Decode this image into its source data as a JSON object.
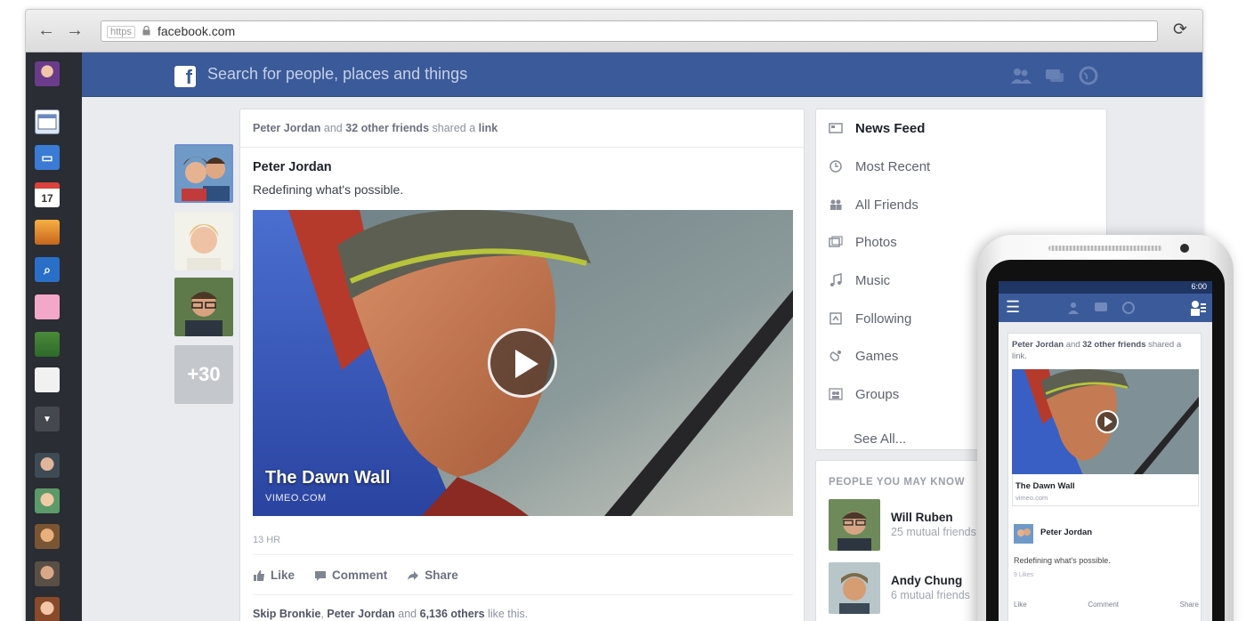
{
  "browser": {
    "url_scheme": "https",
    "url": "facebook.com"
  },
  "header": {
    "search_placeholder": "Search for people, places and things"
  },
  "friends_strip": {
    "more_count": "+30"
  },
  "post": {
    "shared_by": "Peter Jordan",
    "shared_and": "and",
    "shared_others": "32 other friends",
    "shared_verb": "shared a",
    "shared_object": "link",
    "author": "Peter Jordan",
    "text": "Redefining what's possible.",
    "video_title": "The Dawn Wall",
    "video_domain": "VIMEO.COM",
    "time": "13 HR",
    "actions": {
      "like": "Like",
      "comment": "Comment",
      "share": "Share"
    },
    "likes_name1": "Skip Bronkie",
    "likes_name2": "Peter Jordan",
    "likes_and": "and",
    "likes_count": "6,136 others",
    "likes_suffix": "like this."
  },
  "nav": {
    "items": [
      {
        "label": "News Feed",
        "icon": "news-feed-icon"
      },
      {
        "label": "Most Recent",
        "icon": "clock-icon"
      },
      {
        "label": "All Friends",
        "icon": "friends-icon"
      },
      {
        "label": "Photos",
        "icon": "photos-icon"
      },
      {
        "label": "Music",
        "icon": "music-icon"
      },
      {
        "label": "Following",
        "icon": "following-icon"
      },
      {
        "label": "Games",
        "icon": "games-icon"
      },
      {
        "label": "Groups",
        "icon": "groups-icon"
      }
    ],
    "see_all": "See All..."
  },
  "pymk": {
    "title": "PEOPLE YOU MAY KNOW",
    "people": [
      {
        "name": "Will Ruben",
        "mutual": "25 mutual friends"
      },
      {
        "name": "Andy Chung",
        "mutual": "6 mutual friends"
      }
    ]
  },
  "phone": {
    "time": "6:00",
    "shared_by": "Peter Jordan",
    "shared_and": "and",
    "shared_others": "32 other friends",
    "shared_suffix": "shared a link.",
    "link_title": "The Dawn Wall",
    "link_domain": "vimeo.com",
    "author": "Peter Jordan",
    "text": "Redefining what's possible.",
    "likes": "9 Likes",
    "actions": {
      "like": "Like",
      "comment": "Comment",
      "share": "Share"
    }
  },
  "colors": {
    "fb_blue": "#3b5a9a",
    "feed_bg": "#e9ebee",
    "sidebar_dark": "#2a2d33"
  }
}
